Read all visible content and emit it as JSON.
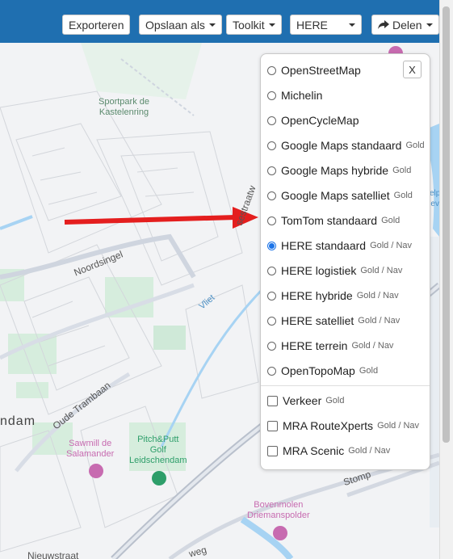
{
  "toolbar": {
    "export_label": "Exporteren",
    "save_as_label": "Opslaan als",
    "toolkit_label": "Toolkit",
    "map_select_value": "HERE",
    "share_label": "Delen"
  },
  "map_labels": {
    "sportpark": "Sportpark de\nKastelenring",
    "noordsingel": "Noordsingel",
    "vliet": "Vliet",
    "oude_trambaan": "Oude Trambaan",
    "ndam": "ndam",
    "sawmill": "Sawmill de\nSalamander",
    "pitch_putt": "Pitch&Putt\nGolf\nLeidschendam",
    "bovenmolen": "Bovenmolen\nDriemanspolder",
    "nieuwstraat": "Nieuwstraat",
    "stomp": "Stomp",
    "weg": "weg",
    "straat": "sestraatw",
    "right_edge": "elp\nev"
  },
  "layer_panel": {
    "close_label": "X",
    "base_layers": [
      {
        "label": "OpenStreetMap",
        "tag": "",
        "selected": false
      },
      {
        "label": "Michelin",
        "tag": "",
        "selected": false
      },
      {
        "label": "OpenCycleMap",
        "tag": "",
        "selected": false
      },
      {
        "label": "Google Maps standaard",
        "tag": "Gold",
        "selected": false
      },
      {
        "label": "Google Maps hybride",
        "tag": "Gold",
        "selected": false
      },
      {
        "label": "Google Maps satelliet",
        "tag": "Gold",
        "selected": false
      },
      {
        "label": "TomTom standaard",
        "tag": "Gold",
        "selected": false
      },
      {
        "label": "HERE standaard",
        "tag": "Gold / Nav",
        "selected": true
      },
      {
        "label": "HERE logistiek",
        "tag": "Gold / Nav",
        "selected": false
      },
      {
        "label": "HERE hybride",
        "tag": "Gold / Nav",
        "selected": false
      },
      {
        "label": "HERE satelliet",
        "tag": "Gold / Nav",
        "selected": false
      },
      {
        "label": "HERE terrein",
        "tag": "Gold / Nav",
        "selected": false
      },
      {
        "label": "OpenTopoMap",
        "tag": "Gold",
        "selected": false
      }
    ],
    "overlays": [
      {
        "label": "Verkeer",
        "tag": "Gold",
        "checked": false
      },
      {
        "label": "MRA RouteXperts",
        "tag": "Gold / Nav",
        "checked": false
      },
      {
        "label": "MRA Scenic",
        "tag": "Gold / Nav",
        "checked": false
      }
    ]
  },
  "colors": {
    "topbar": "#1f6fb0",
    "arrow": "#e41e1e",
    "selected_radio": "#1a73e8"
  }
}
